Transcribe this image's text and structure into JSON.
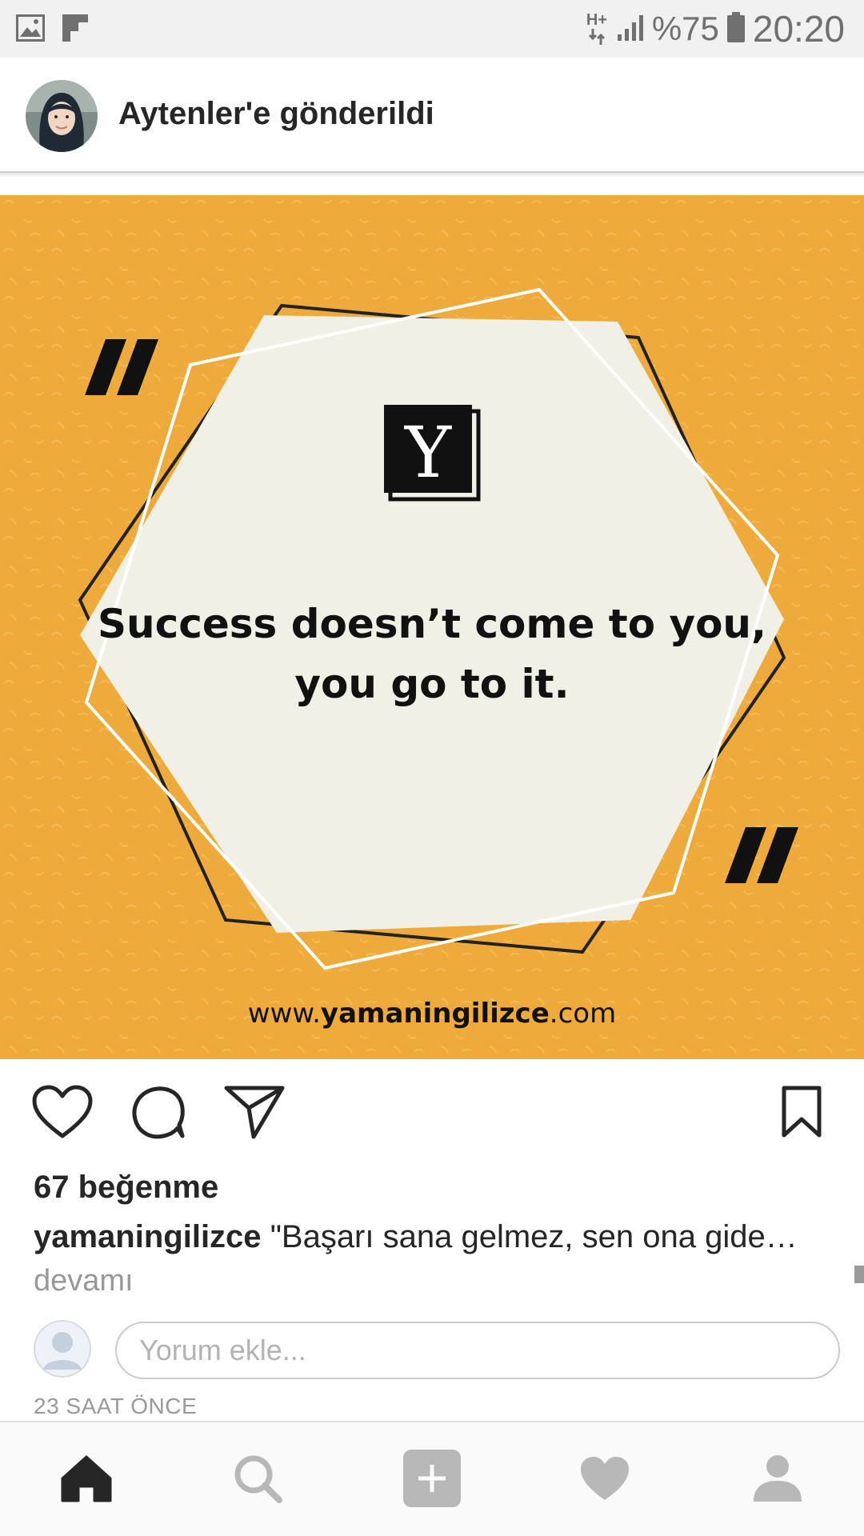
{
  "status_bar": {
    "network": "H+",
    "battery": "%75",
    "time": "20:20"
  },
  "header": {
    "title": "Aytenler'e gönderildi"
  },
  "post": {
    "image": {
      "quote_line1": "Success doesn’t come to you,",
      "quote_line2": "you go to it.",
      "logo_letter": "Y",
      "open_quote": "“",
      "close_quote": "”",
      "url_prefix": "www.",
      "url_brand": "yamaningilizce",
      "url_suffix": ".com",
      "background_color": "#eeab3c"
    },
    "likes": "67 beğenme",
    "username": "yamaningilizce",
    "caption_text": "\"Başarı sana gelmez, sen ona gide…",
    "more_label": "devamı",
    "comment_placeholder": "Yorum ekle...",
    "time_ago": "23 SAAT ÖNCE"
  },
  "icons": {
    "actions": [
      "heart-icon",
      "comment-icon",
      "share-icon",
      "bookmark-icon"
    ],
    "nav": [
      "home-icon",
      "search-icon",
      "add-icon",
      "activity-heart-icon",
      "profile-icon"
    ]
  }
}
